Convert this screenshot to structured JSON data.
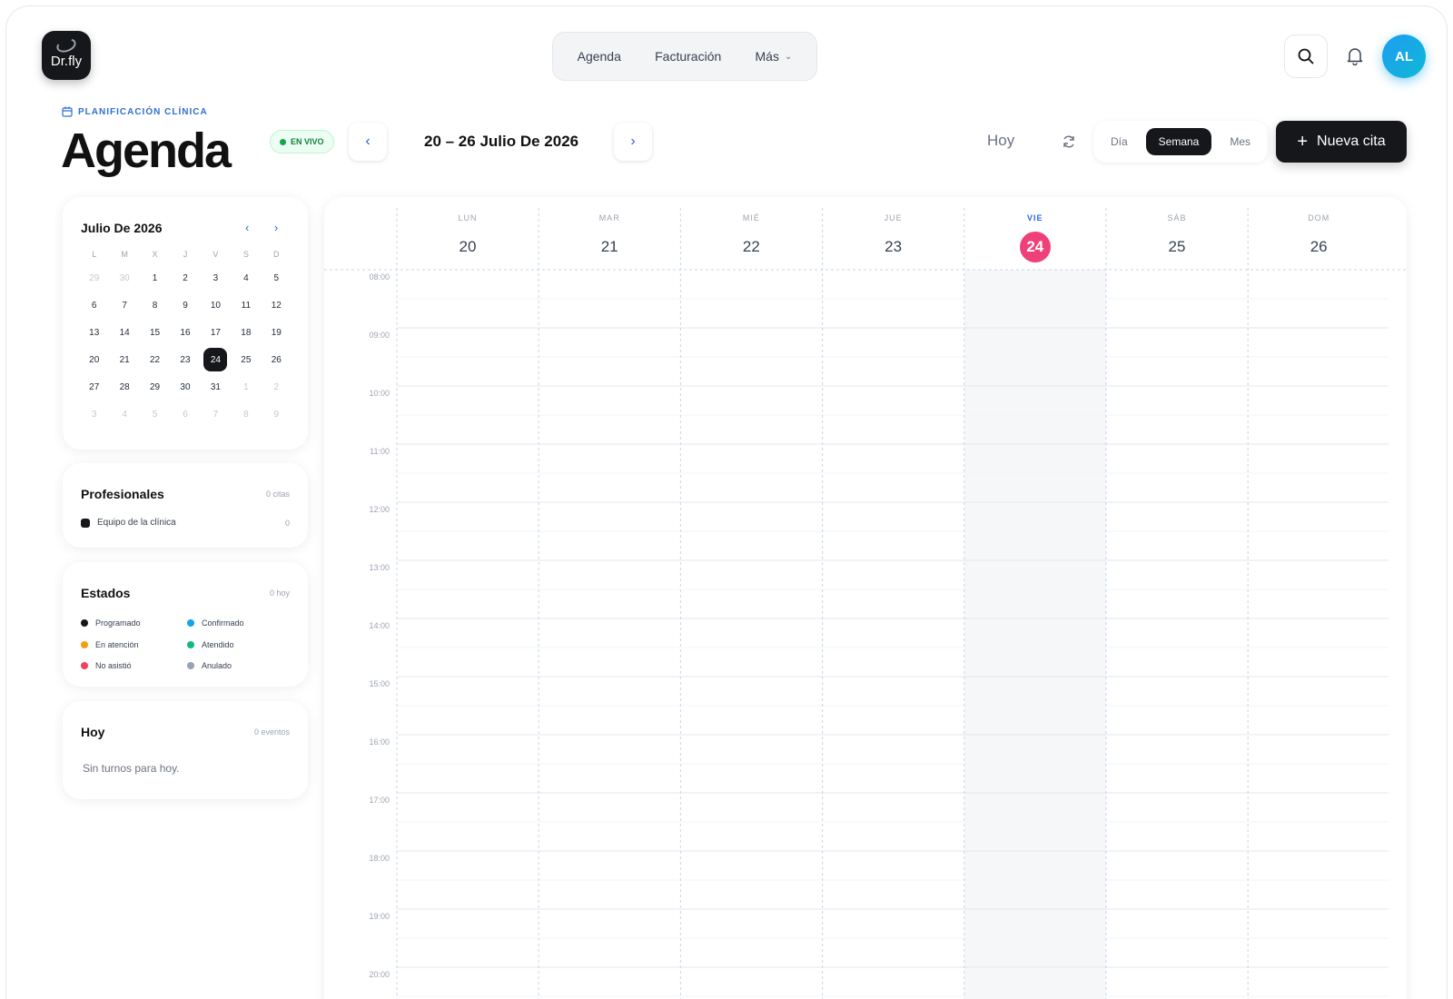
{
  "brand": {
    "logo_text": "Dr.fly"
  },
  "nav": {
    "items": [
      "Agenda",
      "Facturación",
      "Más"
    ]
  },
  "user": {
    "initials": "AL"
  },
  "header": {
    "eyebrow": "PLANIFICACIÓN CLÍNICA",
    "title": "Agenda",
    "live_badge": "EN VIVO",
    "range": "20 – 26 Julio De 2026",
    "today_label": "Hoy",
    "views": [
      "Día",
      "Semana",
      "Mes"
    ],
    "active_view": "Semana",
    "new_button": "Nueva cita"
  },
  "mini_calendar": {
    "title": "Julio De 2026",
    "weekdays": [
      "L",
      "M",
      "X",
      "J",
      "V",
      "S",
      "D"
    ],
    "weeks": [
      [
        "29",
        "30",
        "1",
        "2",
        "3",
        "4",
        "5"
      ],
      [
        "6",
        "7",
        "8",
        "9",
        "10",
        "11",
        "12"
      ],
      [
        "13",
        "14",
        "15",
        "16",
        "17",
        "18",
        "19"
      ],
      [
        "20",
        "21",
        "22",
        "23",
        "24",
        "25",
        "26"
      ],
      [
        "27",
        "28",
        "29",
        "30",
        "31",
        "1",
        "2"
      ],
      [
        "3",
        "4",
        "5",
        "6",
        "7",
        "8",
        "9"
      ]
    ],
    "selected": "24"
  },
  "professionals": {
    "title": "Profesionales",
    "meta": "0 citas",
    "items": [
      {
        "name": "Equipo de la clínica",
        "count": "0",
        "color": "#15171a"
      }
    ]
  },
  "statuses": {
    "title": "Estados",
    "meta": "0 hoy",
    "items": [
      {
        "label": "Programado",
        "color": "#15171a"
      },
      {
        "label": "Confirmado",
        "color": "#0ea5e9"
      },
      {
        "label": "En atención",
        "color": "#f59e0b"
      },
      {
        "label": "Atendido",
        "color": "#10b981"
      },
      {
        "label": "No asistió",
        "color": "#f43f5e"
      },
      {
        "label": "Anulado",
        "color": "#94a3b8"
      }
    ]
  },
  "today": {
    "title": "Hoy",
    "meta": "0 eventos",
    "empty": "Sin turnos para hoy."
  },
  "week": {
    "days": [
      {
        "name": "LUN",
        "num": "20"
      },
      {
        "name": "MAR",
        "num": "21"
      },
      {
        "name": "MIÉ",
        "num": "22"
      },
      {
        "name": "JUE",
        "num": "23"
      },
      {
        "name": "VIE",
        "num": "24"
      },
      {
        "name": "SÁB",
        "num": "25"
      },
      {
        "name": "DOM",
        "num": "26"
      }
    ],
    "today_index": 4,
    "hours": [
      "08:00",
      "09:00",
      "10:00",
      "11:00",
      "12:00",
      "13:00",
      "14:00",
      "15:00",
      "16:00",
      "17:00",
      "18:00",
      "19:00",
      "20:00"
    ]
  },
  "colors": {
    "today_accent": "#f0407a",
    "brand_dark": "#15171a",
    "link_blue": "#2563eb"
  }
}
